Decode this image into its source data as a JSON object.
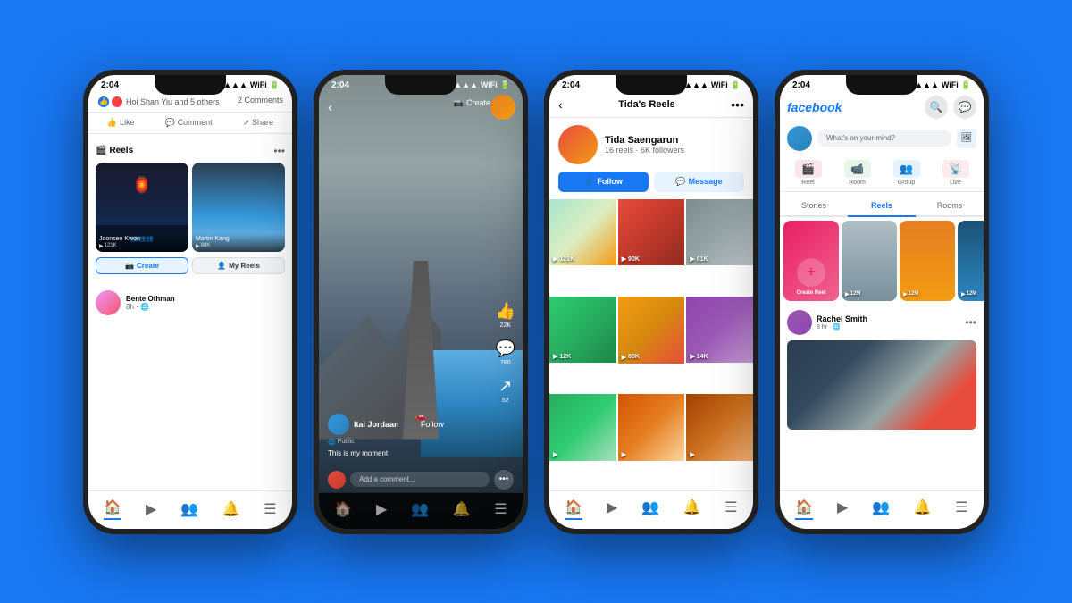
{
  "background": "#1877f2",
  "phones": [
    {
      "id": "phone1",
      "status_time": "2:04",
      "signal": "▲▲▲",
      "wifi": "WiFi",
      "battery": "▮▮▮",
      "reactions": {
        "emojis": [
          "👍",
          "❤️"
        ],
        "text": "Hoi Shan Yiu and 5 others",
        "comments": "2 Comments"
      },
      "actions": [
        "Like",
        "Comment",
        "Share"
      ],
      "reels_label": "Reels",
      "reels": [
        {
          "name": "Joonseo Kwon",
          "count": "121K"
        },
        {
          "name": "Martin Kang",
          "count": "88K"
        }
      ],
      "create_label": "Create",
      "my_reels_label": "My Reels",
      "post_user": "Bente Othman",
      "post_time": "8h · 🌐"
    },
    {
      "id": "phone2",
      "status_time": "2:04",
      "create_label": "Create",
      "user": "Itai Jordaan",
      "verified": true,
      "follow_label": "Follow",
      "public_label": "Public",
      "caption": "This is my moment",
      "comment_placeholder": "Add a comment...",
      "actions": [
        {
          "icon": "👍",
          "count": "22K"
        },
        {
          "icon": "💬",
          "count": "780"
        },
        {
          "icon": "↗",
          "count": "52"
        }
      ]
    },
    {
      "id": "phone3",
      "status_time": "2:04",
      "header_title": "Tida's Reels",
      "profile_name": "Tida Saengarun",
      "profile_stats": "16 reels · 6K followers",
      "follow_label": "Follow",
      "message_label": "Message",
      "grid_items": [
        {
          "count": "121K"
        },
        {
          "count": "90K"
        },
        {
          "count": "81K"
        },
        {
          "count": "12K"
        },
        {
          "count": "80K"
        },
        {
          "count": "14K"
        },
        {
          "count": ""
        },
        {
          "count": ""
        },
        {
          "count": ""
        }
      ]
    },
    {
      "id": "phone4",
      "status_time": "2:04",
      "logo": "facebook",
      "search_placeholder": "What's on your mind?",
      "actions": [
        "Reel",
        "Room",
        "Group",
        "Live"
      ],
      "tabs": [
        "Stories",
        "Reels",
        "Rooms"
      ],
      "active_tab": "Reels",
      "reels": [
        {
          "label": "Create Reel",
          "count": ""
        },
        {
          "count": "12M"
        },
        {
          "count": "12M"
        },
        {
          "count": "12M"
        }
      ],
      "post_user": "Rachel Smith",
      "post_time": "8 hr · 🌐"
    }
  ]
}
